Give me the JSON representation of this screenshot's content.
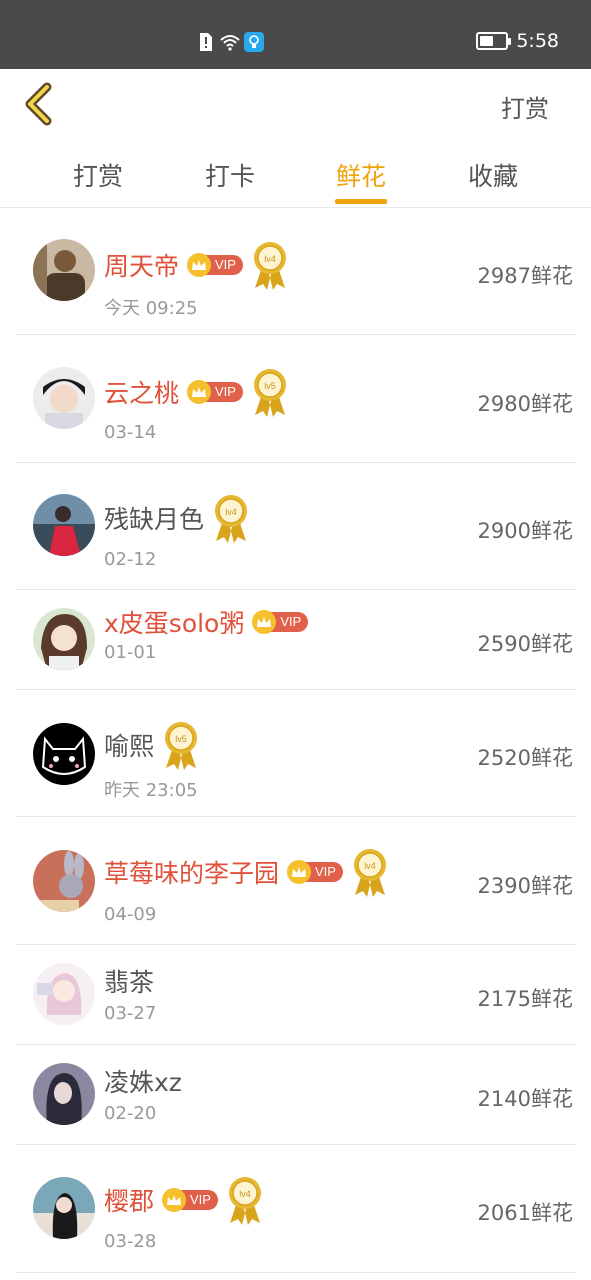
{
  "status_bar": {
    "time": "5:58"
  },
  "nav": {
    "action_label": "打赏"
  },
  "tabs": [
    {
      "label": "打赏"
    },
    {
      "label": "打卡"
    },
    {
      "label": "鲜花"
    },
    {
      "label": "收藏"
    }
  ],
  "active_tab": "鲜花",
  "colors": {
    "accent": "#f2a20a",
    "vip_name": "#e0513a",
    "vip_badge": "#e0604a"
  },
  "rows": [
    {
      "name": "周天帝",
      "vip": true,
      "level": "lv4",
      "date": "今天 09:25",
      "count": "2987鲜花"
    },
    {
      "name": "云之桃",
      "vip": true,
      "level": "lv5",
      "date": "03-14",
      "count": "2980鲜花"
    },
    {
      "name": "残缺月色",
      "vip": false,
      "level": "lv4",
      "date": "02-12",
      "count": "2900鲜花"
    },
    {
      "name": "x皮蛋solo粥",
      "vip": true,
      "level": "",
      "date": "01-01",
      "count": "2590鲜花"
    },
    {
      "name": "喻熙",
      "vip": false,
      "level": "lv5",
      "date": "昨天 23:05",
      "count": "2520鲜花"
    },
    {
      "name": "草莓味的李子园",
      "vip": true,
      "level": "lv4",
      "date": "04-09",
      "count": "2390鲜花"
    },
    {
      "name": "翡茶",
      "vip": false,
      "level": "",
      "date": "03-27",
      "count": "2175鲜花"
    },
    {
      "name": "凌姝xz",
      "vip": false,
      "level": "",
      "date": "02-20",
      "count": "2140鲜花"
    },
    {
      "name": "樱郡",
      "vip": true,
      "level": "lv4",
      "date": "03-28",
      "count": "2061鲜花"
    }
  ]
}
